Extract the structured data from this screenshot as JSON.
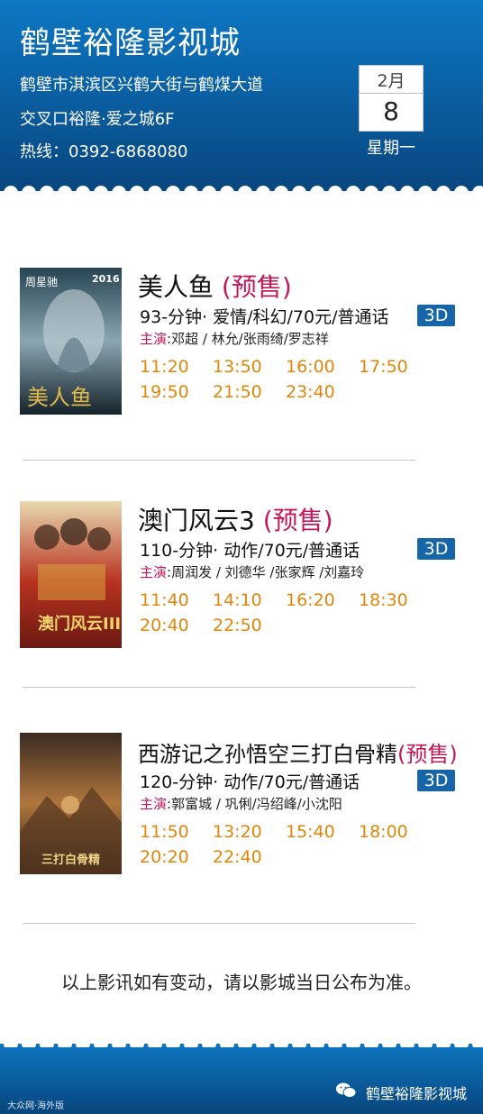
{
  "header": {
    "cinema_name": "鹤壁裕隆影视城",
    "address_line1": "鹤壁市淇滨区兴鹤大街与鹤煤大道",
    "address_line2": "交叉口裕隆·爱之城6F",
    "hotline": "热线：0392-6868080",
    "date": {
      "month": "2月",
      "day": "8",
      "weekday": "星期一"
    }
  },
  "movies": [
    {
      "title": "美人鱼",
      "presale": "(预售)",
      "info": "93-分钟· 爱情/科幻/70元/普通话",
      "format": "3D",
      "cast_label": "主演",
      "cast": ":邓超 / 林允/张雨绮/罗志祥",
      "poster_text": "美人鱼",
      "poster_badge": "2016",
      "poster_tag": "周星驰",
      "poster_colors": [
        "#274452",
        "#8aa6b2",
        "#15232b"
      ],
      "times": [
        "11:20",
        "13:50",
        "16:00",
        "17:50",
        "19:50",
        "21:50",
        "23:40"
      ]
    },
    {
      "title": "澳门风云3",
      "presale": "(预售)",
      "info": "110-分钟· 动作/70元/普通话",
      "format": "3D",
      "cast_label": "主演",
      "cast": ":周润发 / 刘德华 /张家辉 /刘嘉玲",
      "poster_text": "澳门风云III",
      "poster_colors": [
        "#e9d9b0",
        "#b8321f",
        "#6b1a12"
      ],
      "times": [
        "11:40",
        "14:10",
        "16:20",
        "18:30",
        "20:40",
        "22:50"
      ]
    },
    {
      "title": "西游记之孙悟空三打白骨精",
      "presale": "(预售)",
      "info": "120-分钟· 动作/70元/普通话",
      "format": "3D",
      "cast_label": "主演",
      "cast": ":郭富城 / 巩俐/冯绍峰/小沈阳",
      "poster_text": "三打白骨精",
      "poster_colors": [
        "#3b2a22",
        "#b0773d",
        "#2a1c15"
      ],
      "times": [
        "11:50",
        "13:20",
        "15:40",
        "18:00",
        "20:20",
        "22:40"
      ]
    }
  ],
  "notice": "以上影讯如有变动，请以影城当日公布为准。",
  "footer": {
    "brand": "鹤壁裕隆影视城",
    "watermark": "大众网·海外版",
    "wechat_icon": "wechat-icon"
  },
  "colors": {
    "header_blue": "#0d6db5",
    "presale_pink": "#c2185b",
    "time_orange": "#e0860a",
    "badge_blue": "#1565a8"
  }
}
